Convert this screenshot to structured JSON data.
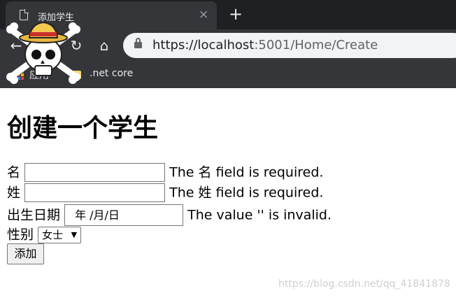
{
  "browser": {
    "tab": {
      "title": "添加学生",
      "close_glyph": "×"
    },
    "new_tab_glyph": "+",
    "nav": {
      "back": "←",
      "forward": "→",
      "reload": "↻",
      "home": "⌂"
    },
    "address": {
      "host": "https://localhost",
      "rest": ":5001/Home/Create"
    },
    "bookmarks": [
      {
        "label": "应用"
      },
      {
        "label": ".net core"
      }
    ]
  },
  "form": {
    "heading": "创建一个学生",
    "fields": [
      {
        "label": "名",
        "value": "",
        "error": "The 名 field is required."
      },
      {
        "label": "姓",
        "value": "",
        "error": "The 姓 field is required."
      },
      {
        "label": "出生日期",
        "value": "年 /月/日",
        "error": "The value '' is invalid."
      },
      {
        "label": "性别",
        "selected": "女士"
      }
    ],
    "submit_label": "添加"
  },
  "watermark": "https://blog.csdn.net/qq_41841878"
}
